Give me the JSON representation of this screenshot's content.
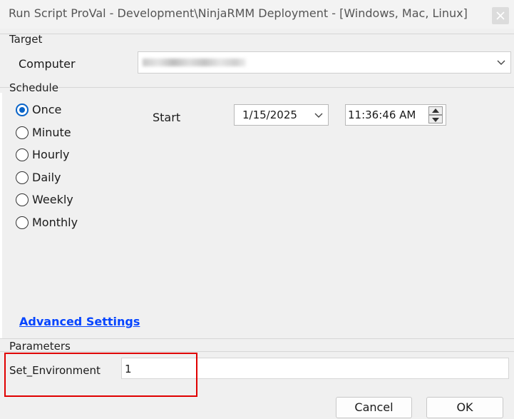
{
  "window": {
    "title": "Run Script ProVal - Development\\NinjaRMM Deployment - [Windows, Mac, Linux]"
  },
  "target": {
    "group_label": "Target",
    "computer_label": "Computer",
    "computer_value": ""
  },
  "schedule": {
    "group_label": "Schedule",
    "options": [
      "Once",
      "Minute",
      "Hourly",
      "Daily",
      "Weekly",
      "Monthly"
    ],
    "selected": "Once",
    "start_label": "Start",
    "start_date": "1/15/2025",
    "start_time": "11:36:46 AM",
    "advanced_link": "Advanced Settings"
  },
  "parameters": {
    "group_label": "Parameters",
    "name": "Set_Environment",
    "value": "1"
  },
  "buttons": {
    "cancel": "Cancel",
    "ok": "OK"
  }
}
